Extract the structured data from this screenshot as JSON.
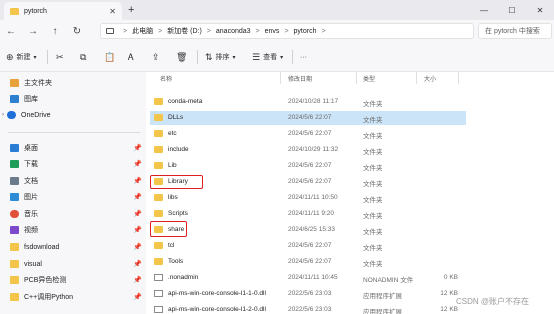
{
  "tab": {
    "title": "pytorch",
    "close": "✕",
    "new": "+"
  },
  "window": {
    "minimize": "—",
    "maximize": "☐",
    "close": "✕"
  },
  "nav": {
    "back": "←",
    "forward": "→",
    "up": "↑",
    "refresh": "↻",
    "crumbs": [
      "此电脑",
      "新加卷 (D:)",
      "anaconda3",
      "envs",
      "pytorch"
    ],
    "separator": ">",
    "search_placeholder": "在 pytorch 中搜索"
  },
  "toolbar": {
    "new_label": "新建",
    "sort_label": "排序",
    "view_label": "查看",
    "more": "···"
  },
  "sidebar": {
    "top": [
      {
        "label": "主文件夹",
        "icon": "home-icon",
        "color": "#e8a23a"
      },
      {
        "label": "图库",
        "icon": "gallery-icon",
        "color": "#2f7fd1"
      },
      {
        "label": "OneDrive",
        "icon": "cloud-icon",
        "color": "#1e6fd8"
      }
    ],
    "quick": [
      {
        "label": "桌面",
        "icon": "desktop-icon",
        "color": "#2b7cd3"
      },
      {
        "label": "下载",
        "icon": "download-icon",
        "color": "#1f9e5a"
      },
      {
        "label": "文档",
        "icon": "document-icon",
        "color": "#6b7b8c"
      },
      {
        "label": "图片",
        "icon": "pictures-icon",
        "color": "#2e8bd6"
      },
      {
        "label": "音乐",
        "icon": "music-icon",
        "color": "#e0513a"
      },
      {
        "label": "视频",
        "icon": "video-icon",
        "color": "#7b49c9"
      },
      {
        "label": "fsdownload",
        "icon": "folder-icon",
        "color": "#f3c54b"
      },
      {
        "label": "visual",
        "icon": "folder-icon",
        "color": "#f3c54b"
      },
      {
        "label": "PCB异色检测",
        "icon": "folder-icon",
        "color": "#f3c54b"
      },
      {
        "label": "C++调用Python",
        "icon": "folder-icon",
        "color": "#f3c54b"
      }
    ],
    "pin": "📌"
  },
  "columns": {
    "name": "名称",
    "date": "修改日期",
    "type": "类型",
    "size": "大小"
  },
  "files": [
    {
      "name": "conda-meta",
      "date": "2024/10/28 11:17",
      "type": "文件夹",
      "size": "",
      "kind": "folder"
    },
    {
      "name": "DLLs",
      "date": "2024/5/6 22:07",
      "type": "文件夹",
      "size": "",
      "kind": "folder"
    },
    {
      "name": "etc",
      "date": "2024/5/6 22:07",
      "type": "文件夹",
      "size": "",
      "kind": "folder"
    },
    {
      "name": "include",
      "date": "2024/10/29 11:32",
      "type": "文件夹",
      "size": "",
      "kind": "folder"
    },
    {
      "name": "Lib",
      "date": "2024/5/6 22:07",
      "type": "文件夹",
      "size": "",
      "kind": "folder"
    },
    {
      "name": "Library",
      "date": "2024/5/6 22:07",
      "type": "文件夹",
      "size": "",
      "kind": "folder"
    },
    {
      "name": "libs",
      "date": "2024/11/11 10:50",
      "type": "文件夹",
      "size": "",
      "kind": "folder"
    },
    {
      "name": "Scripts",
      "date": "2024/11/11 9:20",
      "type": "文件夹",
      "size": "",
      "kind": "folder"
    },
    {
      "name": "share",
      "date": "2024/6/25 15:33",
      "type": "文件夹",
      "size": "",
      "kind": "folder"
    },
    {
      "name": "tcl",
      "date": "2024/5/6 22:07",
      "type": "文件夹",
      "size": "",
      "kind": "folder"
    },
    {
      "name": "Tools",
      "date": "2024/5/6 22:07",
      "type": "文件夹",
      "size": "",
      "kind": "folder"
    },
    {
      "name": ".nonadmin",
      "date": "2024/11/11 10:45",
      "type": "NONADMIN 文件",
      "size": "0 KB",
      "kind": "file"
    },
    {
      "name": "api-ms-win-core-console-l1-1-0.dll",
      "date": "2022/5/6 23:03",
      "type": "应用程序扩展",
      "size": "12 KB",
      "kind": "file"
    },
    {
      "name": "api-ms-win-core-console-l1-2-0.dll",
      "date": "2022/5/6 23:03",
      "type": "应用程序扩展",
      "size": "12 KB",
      "kind": "file"
    }
  ],
  "watermark": "CSDN @账户不存在"
}
